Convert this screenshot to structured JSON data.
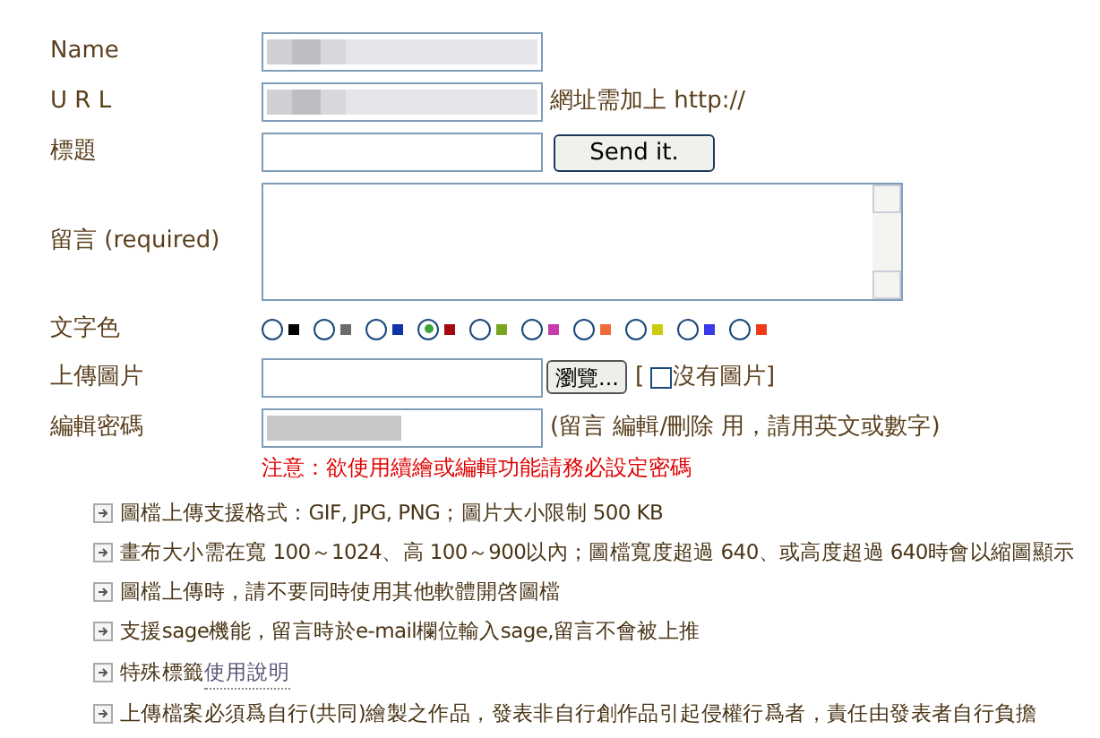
{
  "fields": [
    {
      "label": "Name",
      "kind": "redacted"
    },
    {
      "label": "U R L",
      "kind": "redacted",
      "hint": "網址需加上 http://"
    },
    {
      "label": "標題",
      "kind": "text",
      "button": "Send it."
    },
    {
      "label": "留言 (required)",
      "kind": "textarea"
    }
  ],
  "color_label": "文字色",
  "colors": [
    {
      "color": "#000000",
      "selected": false
    },
    {
      "color": "#6b6b6b",
      "selected": false
    },
    {
      "color": "#1033a8",
      "selected": false
    },
    {
      "color": "#a00a10",
      "selected": true
    },
    {
      "color": "#7aa520",
      "selected": false
    },
    {
      "color": "#c83caa",
      "selected": false
    },
    {
      "color": "#f06a3c",
      "selected": false
    },
    {
      "color": "#cccc10",
      "selected": false
    },
    {
      "color": "#3a3ae8",
      "selected": false
    },
    {
      "color": "#f03a18",
      "selected": false
    }
  ],
  "upload": {
    "label": "上傳圖片",
    "button": "瀏覽...",
    "bracket_open": "[",
    "checkbox_label": "沒有圖片",
    "checked": false,
    "bracket_close": "]"
  },
  "password": {
    "label": "編輯密碼",
    "hint": "(留言 編輯/刪除 用，請用英文或數字)"
  },
  "warning": "注意：欲使用續繪或編輯功能請務必設定密碼",
  "notes": [
    {
      "text": "圖檔上傳支援格式：GIF, JPG, PNG；圖片大小限制 500 KB"
    },
    {
      "text": "畫布大小需在寬 100～1024、高 100～900以內；圖檔寬度超過 640、或高度超過 640時會以縮圖顯示"
    },
    {
      "text": "圖檔上傳時，請不要同時使用其他軟體開啓圖檔"
    },
    {
      "text": "支援sage機能，留言時於e-mail欄位輸入sage,留言不會被上推"
    },
    {
      "text": "特殊標籤",
      "link": "使用說明"
    },
    {
      "text": "上傳檔案必須爲自行(共同)繪製之作品，發表非自行創作品引起侵權行爲者，責任由發表者自行負擔"
    }
  ]
}
